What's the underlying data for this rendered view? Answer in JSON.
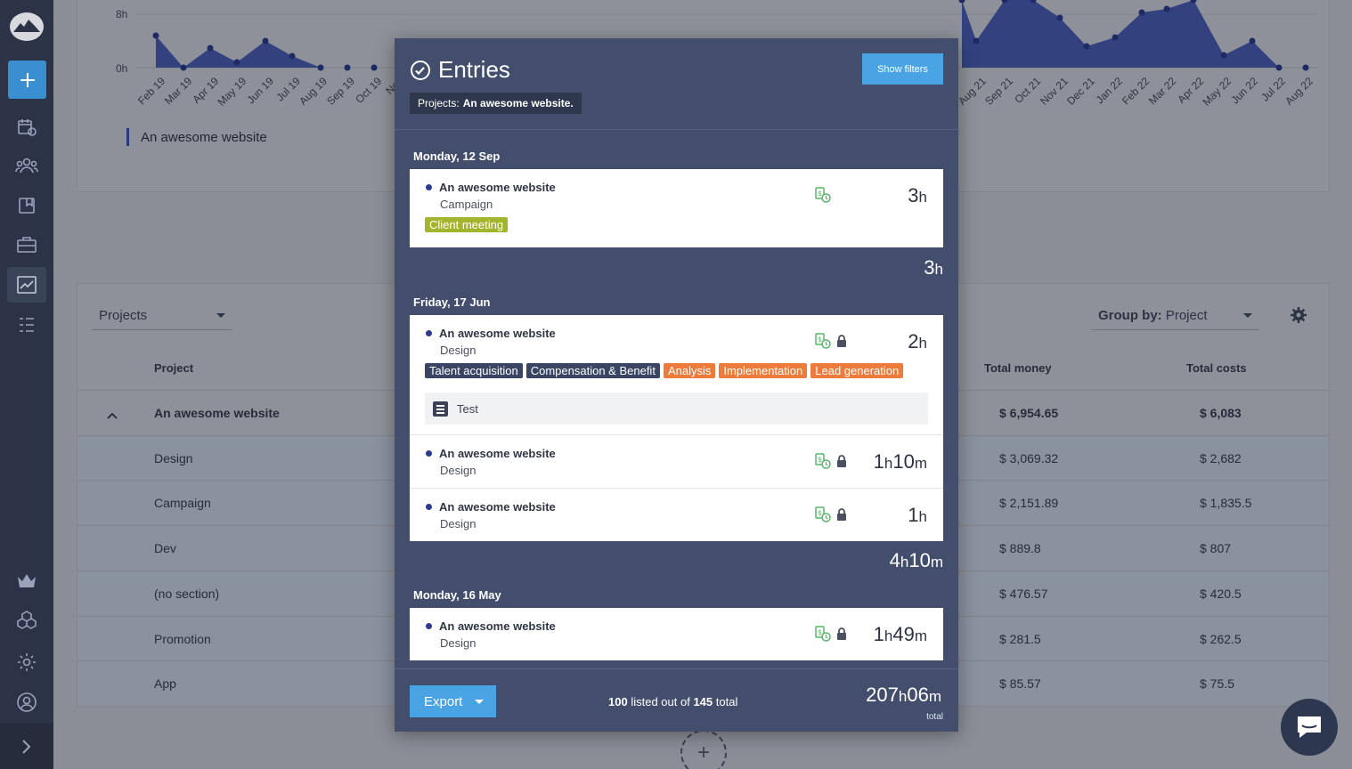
{
  "chart_data": {
    "type": "area",
    "categories": [
      "Feb 19",
      "Mar 19",
      "Apr 19",
      "May 19",
      "Jun 19",
      "Jul 19",
      "Aug 19",
      "Sep 19",
      "Oct 19",
      "Nov",
      "Aug 21",
      "Sep 21",
      "Oct 21",
      "Nov 21",
      "Dec 21",
      "Jan 22",
      "Feb 22",
      "Mar 22",
      "Apr 22",
      "May 22",
      "Jun 22",
      "Jul 22",
      "Aug 22"
    ],
    "y_ticks": [
      "8h",
      "0h"
    ],
    "series": [
      {
        "name": "An awesome website",
        "color": "#293a7c"
      }
    ],
    "legend_position": "bottom-left"
  },
  "table": {
    "dropdown": "Projects",
    "group_by_label": "Group by:",
    "group_by_value": "Project",
    "headers": {
      "project": "Project",
      "total_money": "Total money",
      "total_costs": "Total costs"
    },
    "rows": [
      {
        "name": "An awesome website",
        "money": "$ 6,954.65",
        "costs": "$ 6,083",
        "parent": true
      },
      {
        "name": "Design",
        "money": "$ 3,069.32",
        "costs": "$ 2,682"
      },
      {
        "name": "Campaign",
        "money": "$ 2,151.89",
        "costs": "$ 1,835.5"
      },
      {
        "name": "Dev",
        "money": "$ 889.8",
        "costs": "$ 807"
      },
      {
        "name": "(no section)",
        "money": "$ 476.57",
        "costs": "$ 420.5"
      },
      {
        "name": "Promotion",
        "money": "$ 281.5",
        "costs": "$ 262.5"
      },
      {
        "name": "App",
        "money": "$ 85.57",
        "costs": "$ 75.5"
      }
    ]
  },
  "modal": {
    "title": "Entries",
    "show_filters": "Show filters",
    "filter_label": "Projects:",
    "filter_value": "An awesome website.",
    "days": [
      {
        "label": "Monday, 12 Sep",
        "subtotal": {
          "h": "3",
          "m": ""
        },
        "entries": [
          {
            "project": "An awesome website",
            "section": "Campaign",
            "tags": [
              "Client meeting"
            ],
            "dur_h": "3",
            "dur_m": "",
            "locked": false
          }
        ]
      },
      {
        "label": "Friday, 17 Jun",
        "subtotal": {
          "h": "4",
          "m": "10"
        },
        "entries": [
          {
            "project": "An awesome website",
            "section": "Design",
            "tags": [
              "Talent acquisition",
              "Compensation & Benefit",
              "Analysis",
              "Implementation",
              "Lead generation"
            ],
            "note": "Test",
            "dur_h": "2",
            "dur_m": "",
            "locked": true
          },
          {
            "project": "An awesome website",
            "section": "Design",
            "dur_h": "1",
            "dur_m": "10",
            "locked": true
          },
          {
            "project": "An awesome website",
            "section": "Design",
            "dur_h": "1",
            "dur_m": "",
            "locked": true
          }
        ]
      },
      {
        "label": "Monday, 16 May",
        "entries": [
          {
            "project": "An awesome website",
            "section": "Design",
            "dur_h": "1",
            "dur_m": "49",
            "locked": true
          }
        ]
      }
    ],
    "export": "Export",
    "count_listed": "100",
    "count_mid": "listed out of",
    "count_total": "145",
    "count_suffix": "total",
    "total_h": "207",
    "total_m": "06",
    "total_label": "total"
  },
  "colors": {
    "accent": "#4aa3e3",
    "tag_olive": "#a3b52c",
    "tag_navy": "#3a4564",
    "tag_orange": "#ec7b3c",
    "billable_green": "#58b56a"
  }
}
